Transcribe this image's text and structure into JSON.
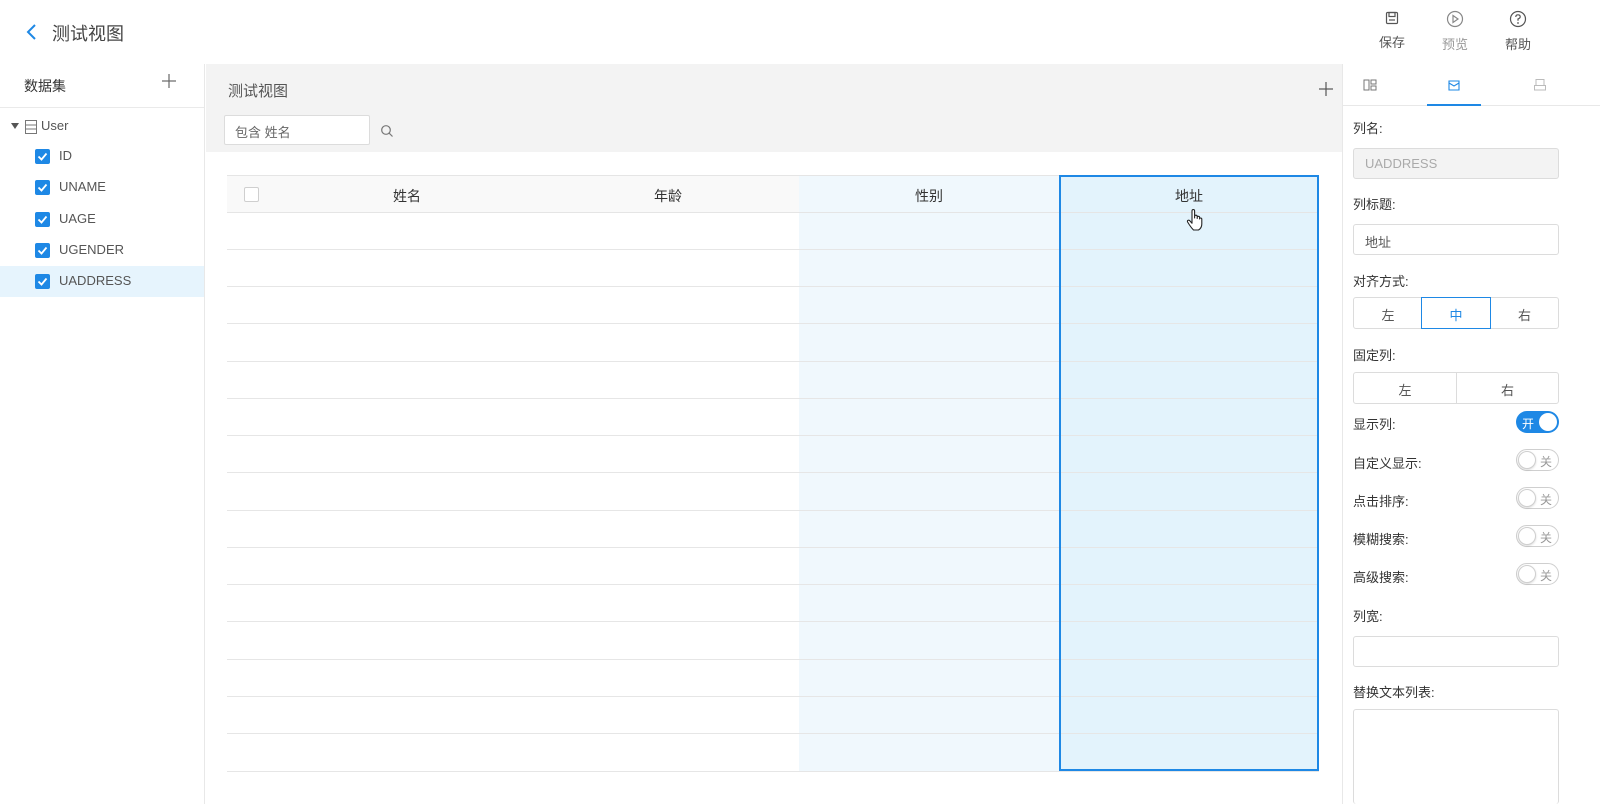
{
  "header": {
    "title": "测试视图",
    "actions": [
      {
        "label": "保存",
        "icon": "save-icon"
      },
      {
        "label": "预览",
        "icon": "preview-icon"
      },
      {
        "label": "帮助",
        "icon": "help-icon"
      }
    ]
  },
  "sidebar": {
    "title": "数据集",
    "dataset": "User",
    "fields": [
      "ID",
      "UNAME",
      "UAGE",
      "UGENDER",
      "UADDRESS"
    ],
    "selected_field": "UADDRESS"
  },
  "canvas": {
    "title": "测试视图",
    "search_text": "包含 姓名",
    "columns": [
      "姓名",
      "年龄",
      "性别",
      "地址"
    ],
    "selected_column": "地址"
  },
  "props": {
    "column_name_label": "列名:",
    "column_name_value": "UADDRESS",
    "column_title_label": "列标题:",
    "column_title_value": "地址",
    "align_label": "对齐方式:",
    "align_options": [
      "左",
      "中",
      "右"
    ],
    "align_selected": "中",
    "fixed_label": "固定列:",
    "fixed_options": [
      "左",
      "右"
    ],
    "show_column_label": "显示列:",
    "show_column_state": "开",
    "custom_display_label": "自定义显示:",
    "custom_display_state": "关",
    "click_sort_label": "点击排序:",
    "click_sort_state": "关",
    "fuzzy_search_label": "模糊搜索:",
    "fuzzy_search_state": "关",
    "advanced_search_label": "高级搜索:",
    "advanced_search_state": "关",
    "width_label": "列宽:",
    "replace_text_label": "替换文本列表:"
  },
  "colors": {
    "accent": "#1e88e5",
    "selected_row_bg": "#e6f4fd",
    "column_shade": "#e3f3fc"
  }
}
